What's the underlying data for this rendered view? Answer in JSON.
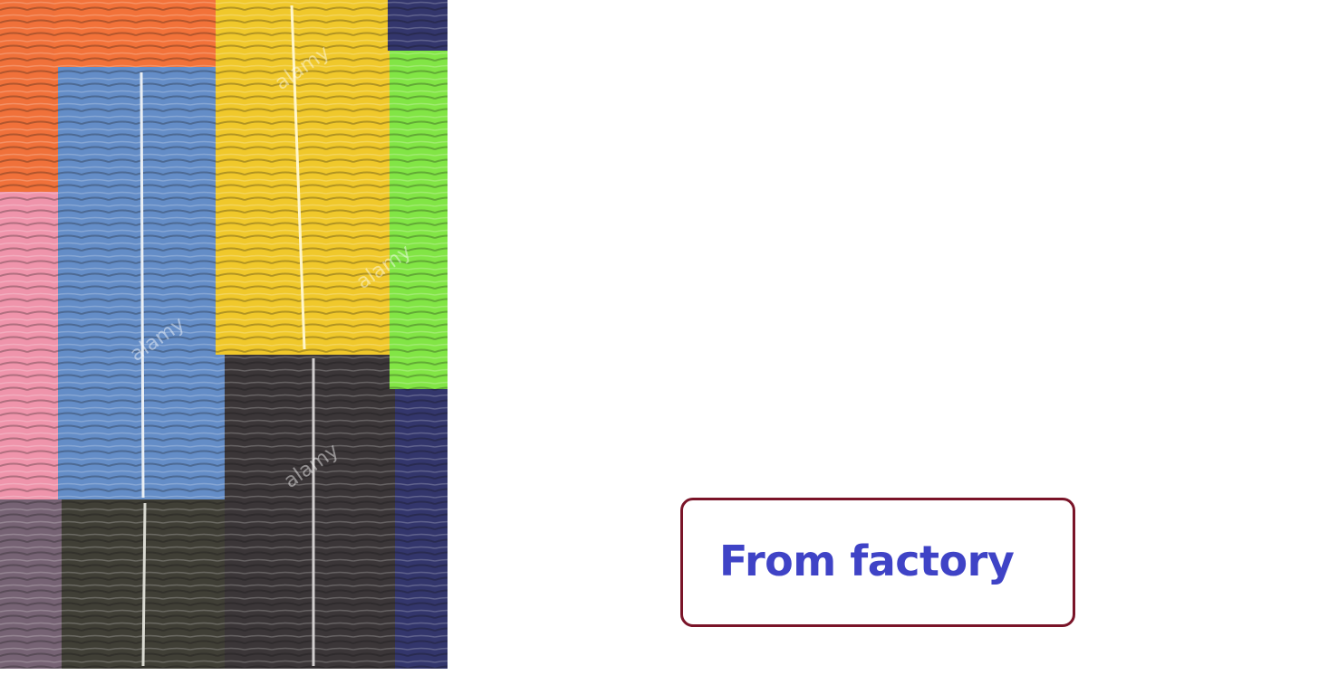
{
  "photo": {
    "subject": "stacks of folded garments wrapped in plastic",
    "watermark": "alamy",
    "stacks": [
      {
        "name": "orange-stack",
        "color": "#f0692e"
      },
      {
        "name": "pink-stack",
        "color": "#ee8ea6"
      },
      {
        "name": "mauve-stack",
        "color": "#6e5a6c"
      },
      {
        "name": "blue-stack",
        "color": "#5b86c4"
      },
      {
        "name": "olive-black-stack",
        "color": "#35332a"
      },
      {
        "name": "yellow-stack",
        "color": "#f0c51e"
      },
      {
        "name": "dark-brown-stack",
        "color": "#2f2a2c"
      },
      {
        "name": "navy-stack",
        "color": "#272a63"
      },
      {
        "name": "green-stack",
        "color": "#7be43a"
      }
    ]
  },
  "label": {
    "text": "From factory",
    "text_color": "#3f43c6",
    "border_color": "#7a1428"
  }
}
